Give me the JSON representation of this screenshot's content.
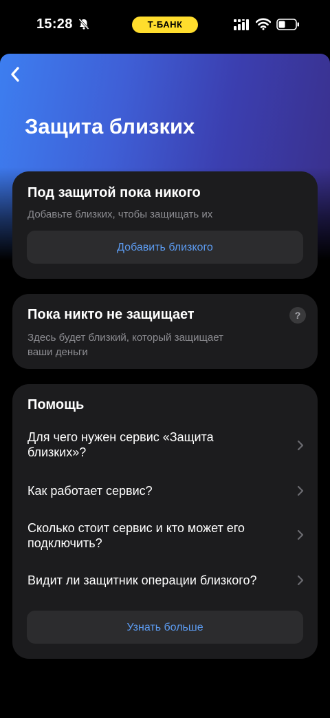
{
  "status_bar": {
    "time": "15:28",
    "carrier_badge": "Т-БАНК",
    "icons": [
      "bell-off-icon",
      "cellular-signal-icon",
      "wifi-icon",
      "battery-icon"
    ]
  },
  "header": {
    "title": "Защита близких",
    "back_icon": "chevron-left-icon"
  },
  "protected_card": {
    "title": "Под защитой пока никого",
    "subtitle": "Добавьте близких, чтобы защищать их",
    "button_label": "Добавить близкого"
  },
  "protectors_card": {
    "title": "Пока никто не защищает",
    "subtitle_line1": "Здесь будет близкий, который защищает",
    "subtitle_line2": "ваши деньги",
    "help_glyph": "?"
  },
  "help_card": {
    "title": "Помощь",
    "items": [
      {
        "line1": "Для чего нужен сервис «Защита",
        "line2": "близких»?"
      },
      {
        "line1": "Как работает сервис?",
        "line2": ""
      },
      {
        "line1": "Сколько стоит сервис и кто может его",
        "line2": "подключить?"
      },
      {
        "line1": "Видит ли защитник операции близкого?",
        "line2": ""
      }
    ],
    "button_label": "Узнать больше"
  },
  "colors": {
    "accent_yellow": "#ffdd2d",
    "link_blue": "#5c9bf0",
    "card_bg": "#1c1c1e",
    "gradient_start": "#3d7ef0",
    "gradient_end": "#3a2f8a"
  }
}
